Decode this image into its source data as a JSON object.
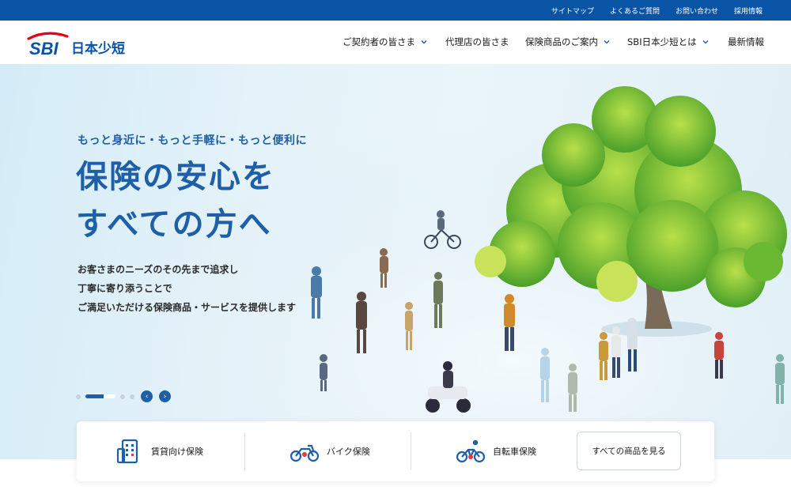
{
  "utility_nav": [
    "サイトマップ",
    "よくあるご質問",
    "お問い合わせ",
    "採用情報"
  ],
  "logo": {
    "mark": "SBI",
    "name": "日本少短"
  },
  "main_nav": [
    {
      "label": "ご契約者の皆さま",
      "dropdown": true
    },
    {
      "label": "代理店の皆さま",
      "dropdown": false
    },
    {
      "label": "保険商品のご案内",
      "dropdown": true
    },
    {
      "label": "SBI日本少短とは",
      "dropdown": true
    },
    {
      "label": "最新情報",
      "dropdown": false
    }
  ],
  "hero": {
    "tagline": "もっと身近に・もっと手軽に・もっと便利に",
    "headline_1": "保険の安心を",
    "headline_2": "すべての方へ",
    "copy_1": "お客さまのニーズのその先まで追求し",
    "copy_2": "丁寧に寄り添うことで",
    "copy_3": "ご満足いただける保険商品・サービスを提供します"
  },
  "carousel": {
    "slides": 5,
    "active_index": 1
  },
  "products": [
    {
      "label": "賃貸向け保険",
      "icon": "building-icon"
    },
    {
      "label": "バイク保険",
      "icon": "motorcycle-icon"
    },
    {
      "label": "自転車保険",
      "icon": "bicycle-icon"
    }
  ],
  "all_products_button": "すべての商品を見る",
  "colors": {
    "brand_blue": "#1d5fa8",
    "topbar_blue": "#0a54a6",
    "logo_red": "#e60012",
    "accent_red": "#e8383d"
  }
}
